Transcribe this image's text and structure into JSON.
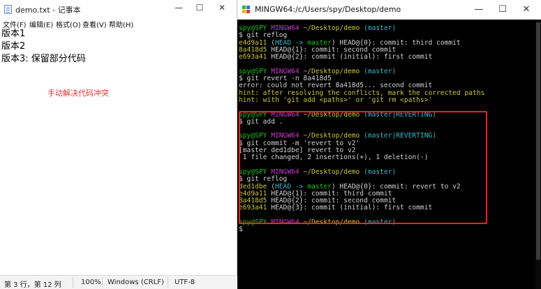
{
  "notepad": {
    "title": "demo.txt - 记事本",
    "controls": {
      "minimize": "—",
      "maximize": "☐",
      "close": "✕"
    },
    "menu": [
      "文件(F)",
      "编辑(E)",
      "格式(O)",
      "查看(V)",
      "帮助(H)"
    ],
    "lines": [
      "版本1",
      "版本2",
      "版本3: 保留部分代码"
    ],
    "note": "手动解决代码冲突",
    "status": {
      "position": "第 3 行，第 12 列",
      "zoom": "100%",
      "line_ending": "Windows (CRLF)",
      "encoding": "UTF-8"
    }
  },
  "terminal": {
    "title": "MINGW64:/c/Users/spy/Desktop/demo",
    "controls": {
      "minimize": "—",
      "maximize": "☐",
      "close": "✕"
    },
    "prompt": {
      "user": "spy@SPY",
      "host": "MINGW64",
      "path": "~/Desktop/demo"
    },
    "lines": [
      [
        [
          "g",
          "spy@SPY "
        ],
        [
          "m",
          "MINGW64 "
        ],
        [
          "y",
          "~/Desktop/demo "
        ],
        [
          "c",
          "(master)"
        ]
      ],
      [
        [
          "w",
          "$ git reflog"
        ]
      ],
      [
        [
          "y",
          "e4d9a11 "
        ],
        [
          "w",
          "("
        ],
        [
          "c",
          "HEAD -> "
        ],
        [
          "g",
          "master"
        ],
        [
          "w",
          ") HEAD@{0}: commit: third commit"
        ]
      ],
      [
        [
          "y",
          "8a418d5 "
        ],
        [
          "w",
          "HEAD@{1}: commit: second commit"
        ]
      ],
      [
        [
          "y",
          "e693a41 "
        ],
        [
          "w",
          "HEAD@{2}: commit (initial): first commit"
        ]
      ],
      [
        [
          "w",
          ""
        ]
      ],
      [
        [
          "g",
          "spy@SPY "
        ],
        [
          "m",
          "MINGW64 "
        ],
        [
          "y",
          "~/Desktop/demo "
        ],
        [
          "c",
          "(master)"
        ]
      ],
      [
        [
          "w",
          "$ git revert -n 8a418d5"
        ]
      ],
      [
        [
          "w",
          "error: could not revert 8a418d5... second commit"
        ]
      ],
      [
        [
          "y",
          "hint: after resolving the conflicts, mark the corrected paths"
        ]
      ],
      [
        [
          "y",
          "hint: with 'git add <paths>' or 'git rm <paths>'"
        ]
      ],
      [
        [
          "w",
          ""
        ]
      ],
      [
        [
          "g",
          "spy@SPY "
        ],
        [
          "m",
          "MINGW64 "
        ],
        [
          "y",
          "~/Desktop/demo "
        ],
        [
          "c",
          "(master|REVERTING)"
        ]
      ],
      [
        [
          "w",
          "$ git add ."
        ]
      ],
      [
        [
          "w",
          ""
        ]
      ],
      [
        [
          "g",
          "spy@SPY "
        ],
        [
          "m",
          "MINGW64 "
        ],
        [
          "y",
          "~/Desktop/demo "
        ],
        [
          "c",
          "(master|REVERTING)"
        ]
      ],
      [
        [
          "w",
          "$ git commit -m 'revert to v2'"
        ]
      ],
      [
        [
          "w",
          "[master ded1dbe] revert to v2"
        ]
      ],
      [
        [
          "w",
          " 1 file changed, 2 insertions(+), 1 deletion(-)"
        ]
      ],
      [
        [
          "w",
          ""
        ]
      ],
      [
        [
          "g",
          "spy@SPY "
        ],
        [
          "m",
          "MINGW64 "
        ],
        [
          "y",
          "~/Desktop/demo "
        ],
        [
          "c",
          "(master)"
        ]
      ],
      [
        [
          "w",
          "$ git reflog"
        ]
      ],
      [
        [
          "y",
          "ded1dbe "
        ],
        [
          "w",
          "("
        ],
        [
          "c",
          "HEAD -> "
        ],
        [
          "g",
          "master"
        ],
        [
          "w",
          ") HEAD@{0}: commit: revert to v2"
        ]
      ],
      [
        [
          "y",
          "e4d9a11 "
        ],
        [
          "w",
          "HEAD@{1}: commit: third commit"
        ]
      ],
      [
        [
          "y",
          "8a418d5 "
        ],
        [
          "w",
          "HEAD@{2}: commit: second commit"
        ]
      ],
      [
        [
          "y",
          "e693a41 "
        ],
        [
          "w",
          "HEAD@{3}: commit (initial): first commit"
        ]
      ],
      [
        [
          "w",
          ""
        ]
      ],
      [
        [
          "g",
          "spy@SPY "
        ],
        [
          "m",
          "MINGW64 "
        ],
        [
          "y",
          "~/Desktop/demo "
        ],
        [
          "c",
          "(master)"
        ]
      ],
      [
        [
          "w",
          "$"
        ]
      ]
    ],
    "colors": {
      "green": "#1dc11d",
      "magenta": "#c838c8",
      "yellow": "#c8c43a",
      "cyan": "#3ab8c8",
      "highlight_border": "#e8261e"
    }
  }
}
